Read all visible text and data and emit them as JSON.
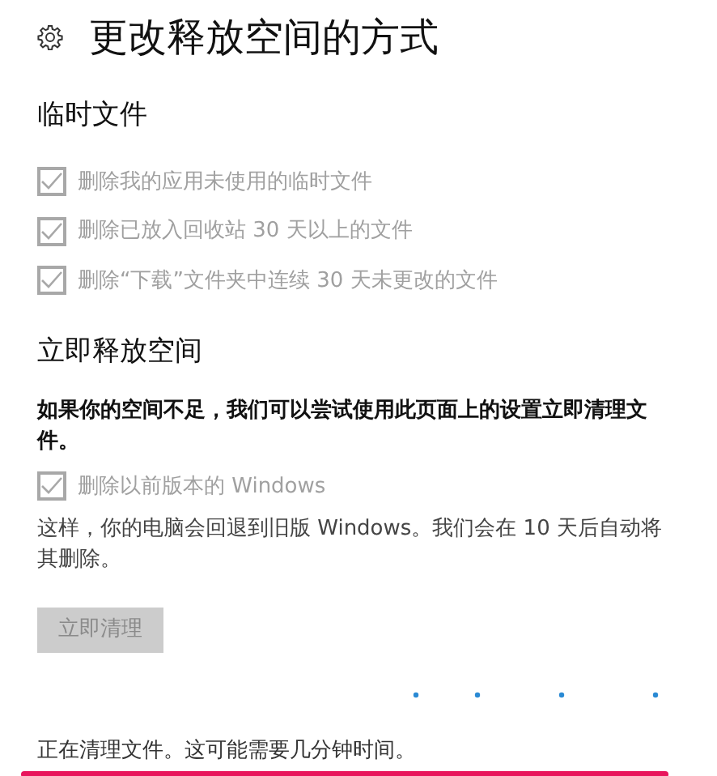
{
  "title": "更改释放空间的方式",
  "temp_section": {
    "heading": "临时文件",
    "options": [
      {
        "label": "删除我的应用未使用的临时文件",
        "checked": true,
        "disabled": true
      },
      {
        "label": "删除已放入回收站 30 天以上的文件",
        "checked": true,
        "disabled": true
      },
      {
        "label": "删除“下载”文件夹中连续 30 天未更改的文件",
        "checked": true,
        "disabled": true
      }
    ]
  },
  "free_section": {
    "heading": "立即释放空间",
    "description": "如果你的空间不足，我们可以尝试使用此页面上的设置立即清理文件。",
    "option": {
      "label": "删除以前版本的 Windows",
      "checked": true,
      "disabled": true
    },
    "note": "这样，你的电脑会回退到旧版 Windows。我们会在 10 天后自动将其删除。",
    "button": {
      "label": "立即清理",
      "disabled": true
    }
  },
  "status": {
    "busy": true,
    "text": "正在清理文件。这可能需要几分钟时间。"
  }
}
